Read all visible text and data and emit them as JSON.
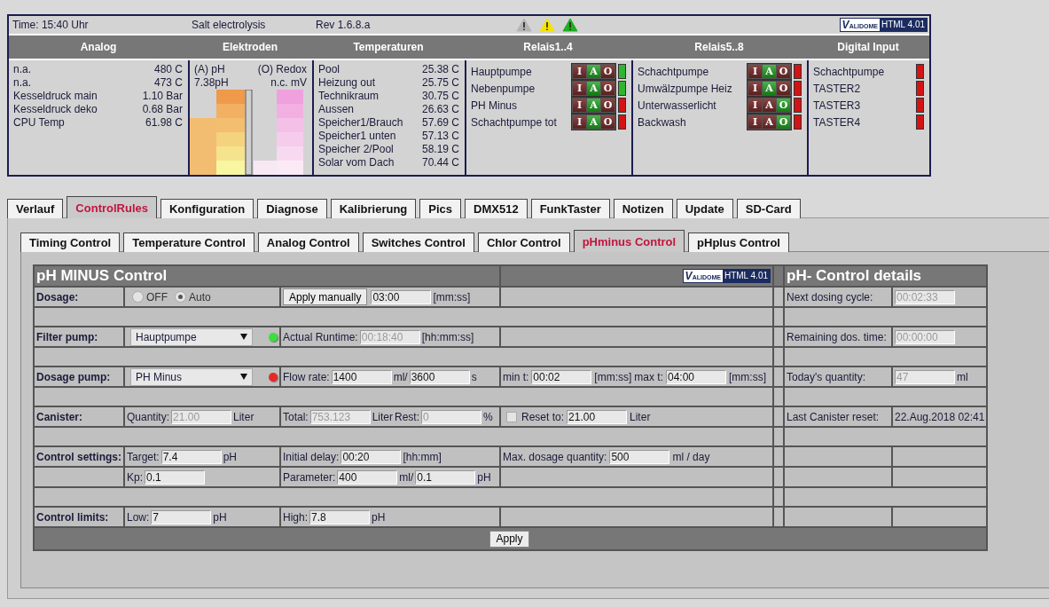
{
  "status": {
    "time": "Time: 15:40 Uhr",
    "mode": "Salt electrolysis",
    "revision": "Rev 1.6.8.a",
    "alerts": [
      {
        "color": "#b4b4b4"
      },
      {
        "color": "#f5e400"
      },
      {
        "color": "#1fae1f"
      }
    ],
    "badge": {
      "logo": "VALIDOME",
      "label": "HTML 4.01"
    }
  },
  "overview": {
    "headings": [
      "Analog",
      "Elektroden",
      "Temperaturen",
      "Relais1..4",
      "Relais5..8",
      "Digital Input"
    ],
    "analog": [
      {
        "label": "n.a.",
        "value": "480 C"
      },
      {
        "label": "n.a.",
        "value": "473 C"
      },
      {
        "label": "Kesseldruck main",
        "value": "1.10 Bar"
      },
      {
        "label": "Kesseldruck deko",
        "value": "0.68 Bar"
      },
      {
        "label": "CPU Temp",
        "value": "61.98 C"
      }
    ],
    "electrodes": {
      "ph_label": "(A) pH",
      "redox_label": "(O) Redox",
      "ph_value": "7.38pH",
      "redox_value": "n.c. mV"
    },
    "temperatures": [
      {
        "label": "Pool",
        "value": "25.38 C"
      },
      {
        "label": "Heizung out",
        "value": "25.75 C"
      },
      {
        "label": "Technikraum",
        "value": "30.75 C"
      },
      {
        "label": "Aussen",
        "value": "26.63 C"
      },
      {
        "label": "Speicher1/Brauch",
        "value": "57.69 C"
      },
      {
        "label": "Speicher1 unten",
        "value": "57.13 C"
      },
      {
        "label": "Speicher 2/Pool",
        "value": "58.19 C"
      },
      {
        "label": "Solar vom Dach",
        "value": "70.44 C"
      }
    ],
    "relays": [
      [
        {
          "label": "Hauptpumpe",
          "on": true,
          "modes": [
            {
              "label": "I",
              "selected": false
            },
            {
              "label": "A",
              "selected": true
            },
            {
              "label": "O",
              "selected": false
            }
          ]
        },
        {
          "label": "Nebenpumpe",
          "on": true,
          "modes": [
            {
              "label": "I",
              "selected": false
            },
            {
              "label": "A",
              "selected": true
            },
            {
              "label": "O",
              "selected": false
            }
          ]
        },
        {
          "label": "PH Minus",
          "on": false,
          "modes": [
            {
              "label": "I",
              "selected": false
            },
            {
              "label": "A",
              "selected": true
            },
            {
              "label": "O",
              "selected": false
            }
          ]
        },
        {
          "label": "Schachtpumpe tot",
          "on": false,
          "modes": [
            {
              "label": "I",
              "selected": false
            },
            {
              "label": "A",
              "selected": true
            },
            {
              "label": "O",
              "selected": false
            }
          ]
        }
      ],
      [
        {
          "label": "Schachtpumpe",
          "on": false,
          "modes": [
            {
              "label": "I",
              "selected": false
            },
            {
              "label": "A",
              "selected": true
            },
            {
              "label": "O",
              "selected": false
            }
          ]
        },
        {
          "label": "Umwälzpumpe Heiz",
          "on": false,
          "modes": [
            {
              "label": "I",
              "selected": false
            },
            {
              "label": "A",
              "selected": true
            },
            {
              "label": "O",
              "selected": false
            }
          ]
        },
        {
          "label": "Unterwasserlicht",
          "on": false,
          "modes": [
            {
              "label": "I",
              "selected": false
            },
            {
              "label": "A",
              "selected": false
            },
            {
              "label": "O",
              "selected": true
            }
          ]
        },
        {
          "label": "Backwash",
          "on": false,
          "modes": [
            {
              "label": "I",
              "selected": false
            },
            {
              "label": "A",
              "selected": false
            },
            {
              "label": "O",
              "selected": true
            }
          ]
        }
      ]
    ],
    "inputs": [
      {
        "label": "Schachtpumpe",
        "on": false
      },
      {
        "label": "TASTER2",
        "on": false
      },
      {
        "label": "TASTER3",
        "on": false
      },
      {
        "label": "TASTER4",
        "on": false
      }
    ]
  },
  "tabs": [
    {
      "label": "Verlauf",
      "selected": false
    },
    {
      "label": "ControlRules",
      "selected": true
    },
    {
      "label": "Konfiguration",
      "selected": false
    },
    {
      "label": "Diagnose",
      "selected": false
    },
    {
      "label": "Kalibrierung",
      "selected": false
    },
    {
      "label": "Pics",
      "selected": false
    },
    {
      "label": "DMX512",
      "selected": false
    },
    {
      "label": "FunkTaster",
      "selected": false
    },
    {
      "label": "Notizen",
      "selected": false
    },
    {
      "label": "Update",
      "selected": false
    },
    {
      "label": "SD-Card",
      "selected": false
    }
  ],
  "subtabs": [
    {
      "label": "Timing Control",
      "selected": false
    },
    {
      "label": "Temperature Control",
      "selected": false
    },
    {
      "label": "Analog Control",
      "selected": false
    },
    {
      "label": "Switches Control",
      "selected": false
    },
    {
      "label": "Chlor Control",
      "selected": false
    },
    {
      "label": "pHminus Control",
      "selected": true
    },
    {
      "label": "pHplus Control",
      "selected": false
    }
  ],
  "form": {
    "title": "pH MINUS Control",
    "badge": {
      "logo": "VALIDOME",
      "label": "HTML 4.01"
    },
    "details_title": "pH- Control details",
    "rows": [
      {
        "kind": "fields",
        "label": "Dosage:",
        "cells": [
          [
            {
              "kind": "radio",
              "label": "OFF",
              "selected": false
            },
            {
              "kind": "radio",
              "label": "Auto",
              "selected": true
            }
          ],
          [
            {
              "kind": "button",
              "label": "Apply manually"
            },
            {
              "kind": "input",
              "value": "03:00",
              "disabled": false
            },
            {
              "kind": "text",
              "text": "[mm:ss]"
            }
          ],
          []
        ],
        "detail": {
          "label": "Next dosing cycle:",
          "items": [
            {
              "kind": "input",
              "value": "00:02:33",
              "disabled": true
            }
          ]
        }
      },
      {
        "kind": "spacer"
      },
      {
        "kind": "fields",
        "label": "Filter pump:",
        "cells": [
          [
            {
              "kind": "select",
              "value": "Hauptpumpe"
            },
            {
              "kind": "led",
              "on": true
            }
          ],
          [
            {
              "kind": "text",
              "text": "Actual Runtime:"
            },
            {
              "kind": "input",
              "value": "00:18:40",
              "disabled": true
            },
            {
              "kind": "text",
              "text": "[hh:mm:ss]"
            }
          ],
          []
        ],
        "detail": {
          "label": "Remaining dos. time:",
          "items": [
            {
              "kind": "input",
              "value": "00:00:00",
              "disabled": true
            }
          ]
        }
      },
      {
        "kind": "spacer"
      },
      {
        "kind": "fields",
        "label": "Dosage pump:",
        "cells": [
          [
            {
              "kind": "select",
              "value": "PH Minus"
            },
            {
              "kind": "led",
              "on": false
            }
          ],
          [
            {
              "kind": "text",
              "text": "Flow rate:"
            },
            {
              "kind": "input",
              "value": "1400",
              "disabled": false
            },
            {
              "kind": "text",
              "text": "ml/"
            },
            {
              "kind": "input",
              "value": "3600",
              "disabled": false
            },
            {
              "kind": "text",
              "text": "s"
            }
          ],
          [
            {
              "kind": "text",
              "text": "min t:"
            },
            {
              "kind": "input",
              "value": "00:02",
              "disabled": false
            },
            {
              "kind": "text",
              "text": "[mm:ss]"
            },
            {
              "kind": "text",
              "text": "max t:"
            },
            {
              "kind": "input",
              "value": "04:00",
              "disabled": false
            },
            {
              "kind": "text",
              "text": "[mm:ss]"
            }
          ]
        ],
        "detail": {
          "label": "Today's quantity:",
          "items": [
            {
              "kind": "input",
              "value": "47",
              "disabled": true
            },
            {
              "kind": "text",
              "text": "ml"
            }
          ]
        }
      },
      {
        "kind": "spacer"
      },
      {
        "kind": "fields",
        "label": "Canister:",
        "cells": [
          [
            {
              "kind": "text",
              "text": "Quantity:"
            },
            {
              "kind": "input",
              "value": "21.00",
              "disabled": true
            },
            {
              "kind": "text",
              "text": "Liter"
            }
          ],
          [
            {
              "kind": "text",
              "text": "Total:"
            },
            {
              "kind": "input",
              "value": "753.123",
              "disabled": true
            },
            {
              "kind": "text",
              "text": "Liter"
            },
            {
              "kind": "text",
              "text": "Rest:"
            },
            {
              "kind": "input",
              "value": "0",
              "disabled": true
            },
            {
              "kind": "text",
              "text": "%"
            }
          ],
          [
            {
              "kind": "checkbox",
              "label": "Reset to:",
              "checked": false
            },
            {
              "kind": "input",
              "value": "21.00",
              "disabled": false
            },
            {
              "kind": "text",
              "text": "Liter"
            }
          ]
        ],
        "detail": {
          "label": "Last Canister reset:",
          "items": [
            {
              "kind": "text",
              "text": "22.Aug.2018 02:41"
            }
          ]
        }
      },
      {
        "kind": "spacer"
      },
      {
        "kind": "fields",
        "label": "Control settings:",
        "cells": [
          [
            {
              "kind": "text",
              "text": "Target:"
            },
            {
              "kind": "input",
              "value": "7.4",
              "disabled": false
            },
            {
              "kind": "text",
              "text": "pH"
            }
          ],
          [
            {
              "kind": "text",
              "text": "Initial delay:"
            },
            {
              "kind": "input",
              "value": "00:20",
              "disabled": false
            },
            {
              "kind": "text",
              "text": "[hh:mm]"
            }
          ],
          [
            {
              "kind": "text",
              "text": "Max. dosage quantity:"
            },
            {
              "kind": "input",
              "value": "500",
              "disabled": false
            },
            {
              "kind": "text",
              "text": "ml / day"
            }
          ]
        ]
      },
      {
        "kind": "fields",
        "cells": [
          [
            {
              "kind": "text",
              "text": "Kp:"
            },
            {
              "kind": "input",
              "value": "0.1",
              "disabled": false
            }
          ],
          [
            {
              "kind": "text",
              "text": "Parameter:"
            },
            {
              "kind": "input",
              "value": "400",
              "disabled": false
            },
            {
              "kind": "text",
              "text": "ml/"
            },
            {
              "kind": "input",
              "value": "0.1",
              "disabled": false
            },
            {
              "kind": "text",
              "text": "pH"
            }
          ],
          []
        ]
      },
      {
        "kind": "spacer"
      },
      {
        "kind": "fields",
        "label": "Control limits:",
        "cells": [
          [
            {
              "kind": "text",
              "text": "Low:"
            },
            {
              "kind": "input",
              "value": "7",
              "disabled": false
            },
            {
              "kind": "text",
              "text": "pH"
            }
          ],
          [
            {
              "kind": "text",
              "text": "High:"
            },
            {
              "kind": "input",
              "value": "7.8",
              "disabled": false
            },
            {
              "kind": "text",
              "text": "pH"
            }
          ],
          []
        ]
      }
    ],
    "apply": "Apply"
  }
}
